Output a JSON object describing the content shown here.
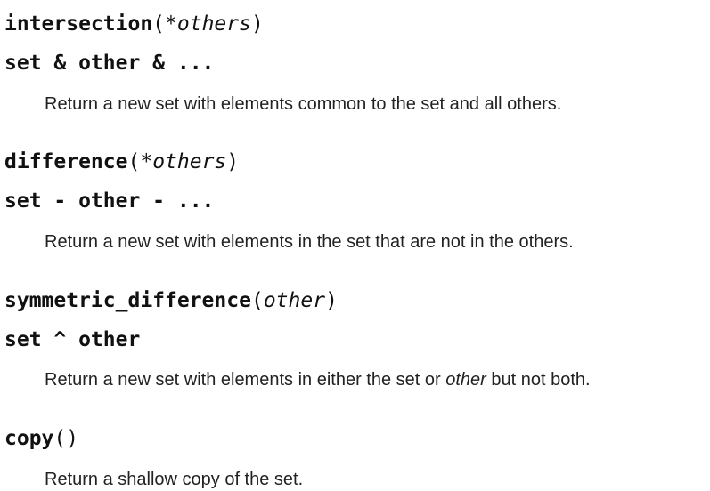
{
  "entries": [
    {
      "method": "intersection",
      "args": "*others",
      "operator_form": "set & other & ...",
      "description": "Return a new set with elements common to the set and all others."
    },
    {
      "method": "difference",
      "args": "*others",
      "operator_form": "set - other - ...",
      "description": "Return a new set with elements in the set that are not in the others."
    },
    {
      "method": "symmetric_difference",
      "args": "other",
      "operator_form": "set ^ other",
      "description_before": "Return a new set with elements in either the set or ",
      "description_em": "other",
      "description_after": " but not both."
    },
    {
      "method": "copy",
      "args": "",
      "description": "Return a shallow copy of the set."
    }
  ],
  "punct": {
    "open_paren": "(",
    "close_paren": ")"
  }
}
